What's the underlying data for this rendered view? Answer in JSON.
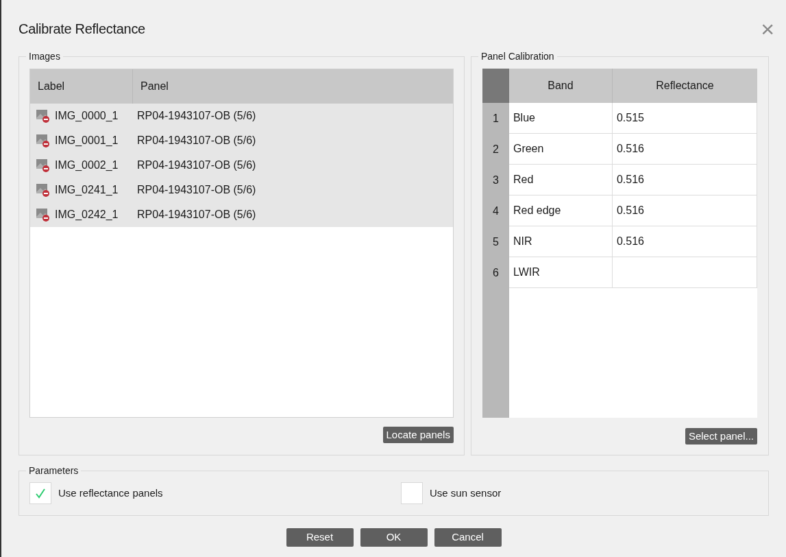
{
  "window": {
    "title": "Calibrate Reflectance",
    "close": "×"
  },
  "images": {
    "title": "Images",
    "columns": [
      "Label",
      "Panel"
    ],
    "rows": [
      {
        "label": "IMG_0000_1",
        "panel": "RP04-1943107-OB (5/6)",
        "selected": true
      },
      {
        "label": "IMG_0001_1",
        "panel": "RP04-1943107-OB (5/6)",
        "selected": true
      },
      {
        "label": "IMG_0002_1",
        "panel": "RP04-1943107-OB (5/6)",
        "selected": true
      },
      {
        "label": "IMG_0241_1",
        "panel": "RP04-1943107-OB (5/6)",
        "selected": true
      },
      {
        "label": "IMG_0242_1",
        "panel": "RP04-1943107-OB (5/6)",
        "selected": true
      }
    ],
    "button": "Locate panels"
  },
  "panel_calibration": {
    "title": "Panel Calibration",
    "columns": [
      "Band",
      "Reflectance"
    ],
    "rows": [
      {
        "number": "1",
        "band": "Blue",
        "reflectance": "0.515"
      },
      {
        "number": "2",
        "band": "Green",
        "reflectance": "0.516"
      },
      {
        "number": "3",
        "band": "Red",
        "reflectance": "0.516"
      },
      {
        "number": "4",
        "band": "Red edge",
        "reflectance": "0.516"
      },
      {
        "number": "5",
        "band": "NIR",
        "reflectance": "0.516"
      },
      {
        "number": "6",
        "band": "LWIR"
      }
    ],
    "button": "Select panel..."
  },
  "parameters": {
    "title": "Parameters",
    "options": [
      {
        "label": "Use reflectance panels",
        "checked": true
      },
      {
        "label": "Use sun sensor",
        "checked": false
      }
    ]
  },
  "buttons": [
    "Reset",
    "OK",
    "Cancel"
  ]
}
